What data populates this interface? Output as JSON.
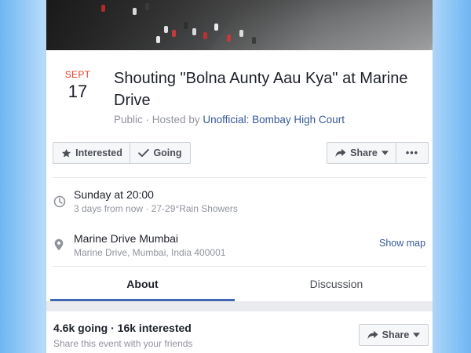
{
  "event": {
    "date": {
      "month": "SEPT",
      "day": "17"
    },
    "title": "Shouting \"Bolna Aunty Aau Kya\" at Marine Drive",
    "visibility": "Public",
    "hosted_by_label": "Hosted by",
    "host": "Unofficial: Bombay High Court"
  },
  "actions": {
    "interested_label": "Interested",
    "going_label": "Going",
    "share_label": "Share",
    "more_label": "•••"
  },
  "details": {
    "time": {
      "main": "Sunday at 20:00",
      "sub": "3 days from now · 27-29°Rain Showers"
    },
    "location": {
      "main": "Marine Drive Mumbai",
      "sub": "Marine Drive, Mumbai, India 400001",
      "show_map_label": "Show map"
    }
  },
  "tabs": [
    {
      "label": "About",
      "active": true
    },
    {
      "label": "Discussion",
      "active": false
    }
  ],
  "summary": {
    "stats": "4.6k going · 16k interested",
    "subtitle": "Share this event with your friends",
    "share_label": "Share"
  },
  "icons": [
    "star-icon",
    "check-icon",
    "share-arrow-icon",
    "caret-down-icon",
    "clock-icon",
    "location-pin-icon"
  ],
  "colors": {
    "accent": "#4267b2",
    "link": "#365899",
    "date_month": "#e9432c",
    "muted": "#90949c"
  }
}
